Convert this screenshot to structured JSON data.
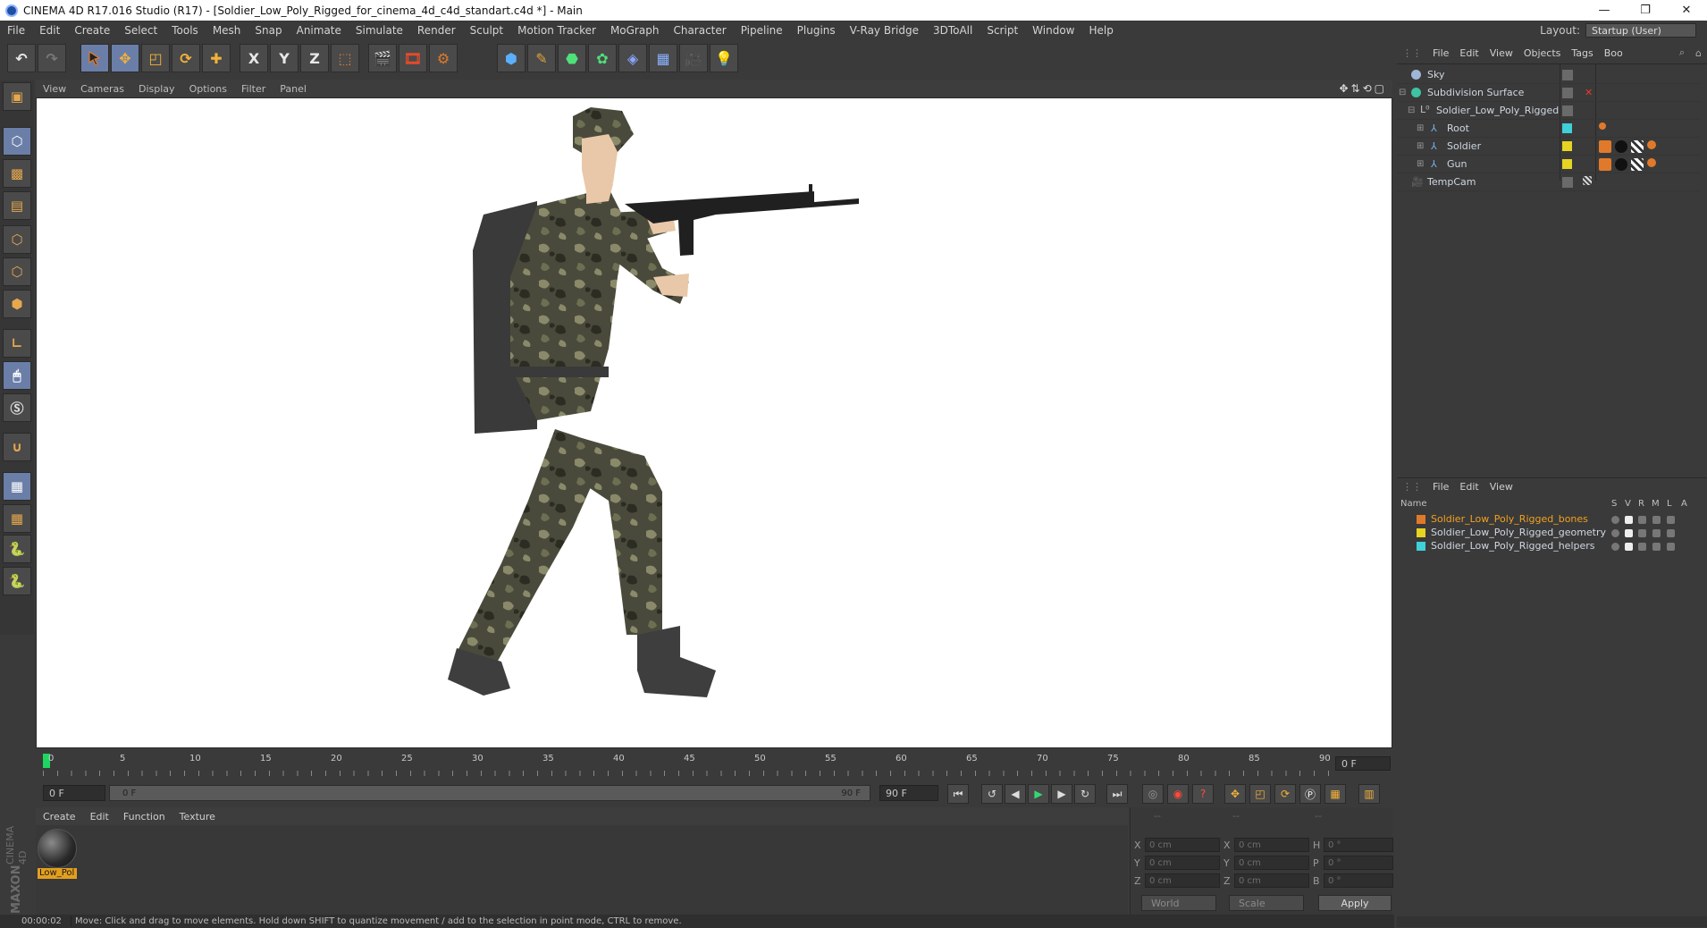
{
  "window": {
    "title": "CINEMA 4D R17.016 Studio (R17) - [Soldier_Low_Poly_Rigged_for_cinema_4d_c4d_standart.c4d *] - Main",
    "controls": [
      "—",
      "❐",
      "✕"
    ]
  },
  "menubar": {
    "items": [
      "File",
      "Edit",
      "Create",
      "Select",
      "Tools",
      "Mesh",
      "Snap",
      "Animate",
      "Simulate",
      "Render",
      "Sculpt",
      "Motion Tracker",
      "MoGraph",
      "Character",
      "Pipeline",
      "Plugins",
      "V-Ray Bridge",
      "3DToAll",
      "Script",
      "Window",
      "Help"
    ],
    "layout_label": "Layout:",
    "layout_value": "Startup (User)"
  },
  "toolbar": {
    "axis_x": "X",
    "axis_y": "Y",
    "axis_z": "Z"
  },
  "viewport": {
    "menu": [
      "View",
      "Cameras",
      "Display",
      "Options",
      "Filter",
      "Panel"
    ],
    "nav_icons": "✥⇅⟲▢"
  },
  "timeline": {
    "ticks": [
      "0",
      "5",
      "10",
      "15",
      "20",
      "25",
      "30",
      "35",
      "40",
      "45",
      "50",
      "55",
      "60",
      "65",
      "70",
      "75",
      "80",
      "85",
      "90"
    ],
    "current_frame": "0 F"
  },
  "transport": {
    "start_field": "0 F",
    "range_start": "0 F",
    "range_end": "90 F",
    "end_field": "90 F"
  },
  "materials": {
    "menu": [
      "Create",
      "Edit",
      "Function",
      "Texture"
    ],
    "items": [
      {
        "name": "Low_Pol"
      }
    ]
  },
  "brand": {
    "line1": "MAXON",
    "line2": "CINEMA 4D"
  },
  "coordinates": {
    "headers": [
      "--",
      "--",
      "--"
    ],
    "rows": [
      {
        "a": "X",
        "v1": "0 cm",
        "b": "X",
        "v2": "0 cm",
        "c": "H",
        "v3": "0 °"
      },
      {
        "a": "Y",
        "v1": "0 cm",
        "b": "Y",
        "v2": "0 cm",
        "c": "P",
        "v3": "0 °"
      },
      {
        "a": "Z",
        "v1": "0 cm",
        "b": "Z",
        "v2": "0 cm",
        "c": "B",
        "v3": "0 °"
      }
    ],
    "mode1": "World",
    "mode2": "Scale",
    "apply": "Apply"
  },
  "status": {
    "time": "00:00:02",
    "message": "Move: Click and drag to move elements. Hold down SHIFT to quantize movement / add to the selection in point mode, CTRL to remove."
  },
  "object_manager": {
    "menu": [
      "File",
      "Edit",
      "View",
      "Objects",
      "Tags",
      "Boo"
    ],
    "objects": [
      {
        "name": "Sky",
        "color": "#9fb6d8"
      },
      {
        "name": "Subdivision Surface",
        "color": "#3fc3a2"
      },
      {
        "name": "Soldier_Low_Poly_Rigged",
        "color": "#c0c0c0"
      },
      {
        "name": "Root",
        "color": "#7aaee8",
        "layer": "#3fd0d8"
      },
      {
        "name": "Soldier",
        "color": "#7aaee8",
        "layer": "#e6d422"
      },
      {
        "name": "Gun",
        "color": "#7aaee8",
        "layer": "#e6d422"
      },
      {
        "name": "TempCam",
        "color": "#c0c0c0"
      }
    ]
  },
  "layer_manager": {
    "menu": [
      "File",
      "Edit",
      "View"
    ],
    "columns": [
      "Name",
      "S",
      "V",
      "R",
      "M",
      "L",
      "A"
    ],
    "layers": [
      {
        "name": "Soldier_Low_Poly_Rigged_bones",
        "color": "#e07a2a"
      },
      {
        "name": "Soldier_Low_Poly_Rigged_geometry",
        "color": "#e6d422"
      },
      {
        "name": "Soldier_Low_Poly_Rigged_helpers",
        "color": "#3fd0d8"
      }
    ]
  }
}
